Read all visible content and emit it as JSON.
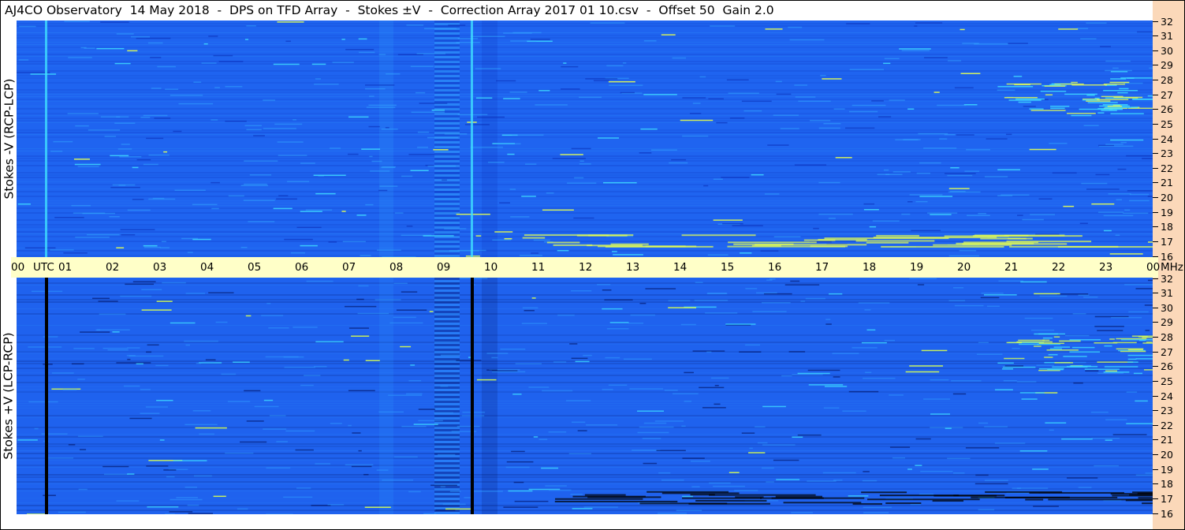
{
  "title": "AJ4CO Observatory  14 May 2018  -  DPS on TFD Array  -  Stokes ±V  -  Correction Array 2017 01 10.csv  -  Offset 50  Gain 2.0",
  "chart_data": [
    {
      "type": "heatmap",
      "ylabel": "Stokes -V (RCP-LCP)",
      "ylim": [
        16,
        32
      ],
      "yticks": [
        "32",
        "31",
        "30",
        "29",
        "28",
        "27",
        "26",
        "25",
        "24",
        "23",
        "22",
        "21",
        "20",
        "19",
        "18",
        "17",
        "16"
      ],
      "xticks": [
        "00",
        "UTC",
        "01",
        "02",
        "03",
        "04",
        "05",
        "06",
        "07",
        "08",
        "09",
        "10",
        "11",
        "12",
        "13",
        "14",
        "15",
        "16",
        "17",
        "18",
        "19",
        "20",
        "21",
        "22",
        "23",
        "00"
      ],
      "colors": {
        "background": "#1f64f0",
        "dark": "#0a2fb8",
        "light": "#33a8ff",
        "cyan": "#40e0ff",
        "yellow": "#e6ff50",
        "red": "#ff3030"
      }
    },
    {
      "type": "heatmap",
      "ylabel": "Stokes +V (LCP-RCP)",
      "ylim": [
        16,
        32
      ],
      "yticks": [
        "32",
        "31",
        "30",
        "29",
        "28",
        "27",
        "26",
        "25",
        "24",
        "23",
        "22",
        "21",
        "20",
        "19",
        "18",
        "17",
        "16"
      ],
      "colors": {
        "background": "#1f62ee",
        "dark": "#001060",
        "light": "#2f9cff",
        "cyan": "#3cd8ff",
        "yellow": "#d8ff50",
        "black": "#000000"
      }
    }
  ],
  "time_axis": {
    "labels": [
      "00",
      "UTC",
      "01",
      "02",
      "03",
      "04",
      "05",
      "06",
      "07",
      "08",
      "09",
      "10",
      "11",
      "12",
      "13",
      "14",
      "15",
      "16",
      "17",
      "18",
      "19",
      "20",
      "21",
      "22",
      "23",
      "00",
      "MHz"
    ]
  },
  "mhz_axis_top": [
    "32",
    "31",
    "30",
    "29",
    "28",
    "27",
    "26",
    "25",
    "24",
    "23",
    "22",
    "21",
    "20",
    "19",
    "18",
    "17",
    "16"
  ],
  "mhz_axis_bottom": [
    "32",
    "31",
    "30",
    "29",
    "28",
    "27",
    "26",
    "25",
    "24",
    "23",
    "22",
    "21",
    "20",
    "19",
    "18",
    "17",
    "16"
  ]
}
